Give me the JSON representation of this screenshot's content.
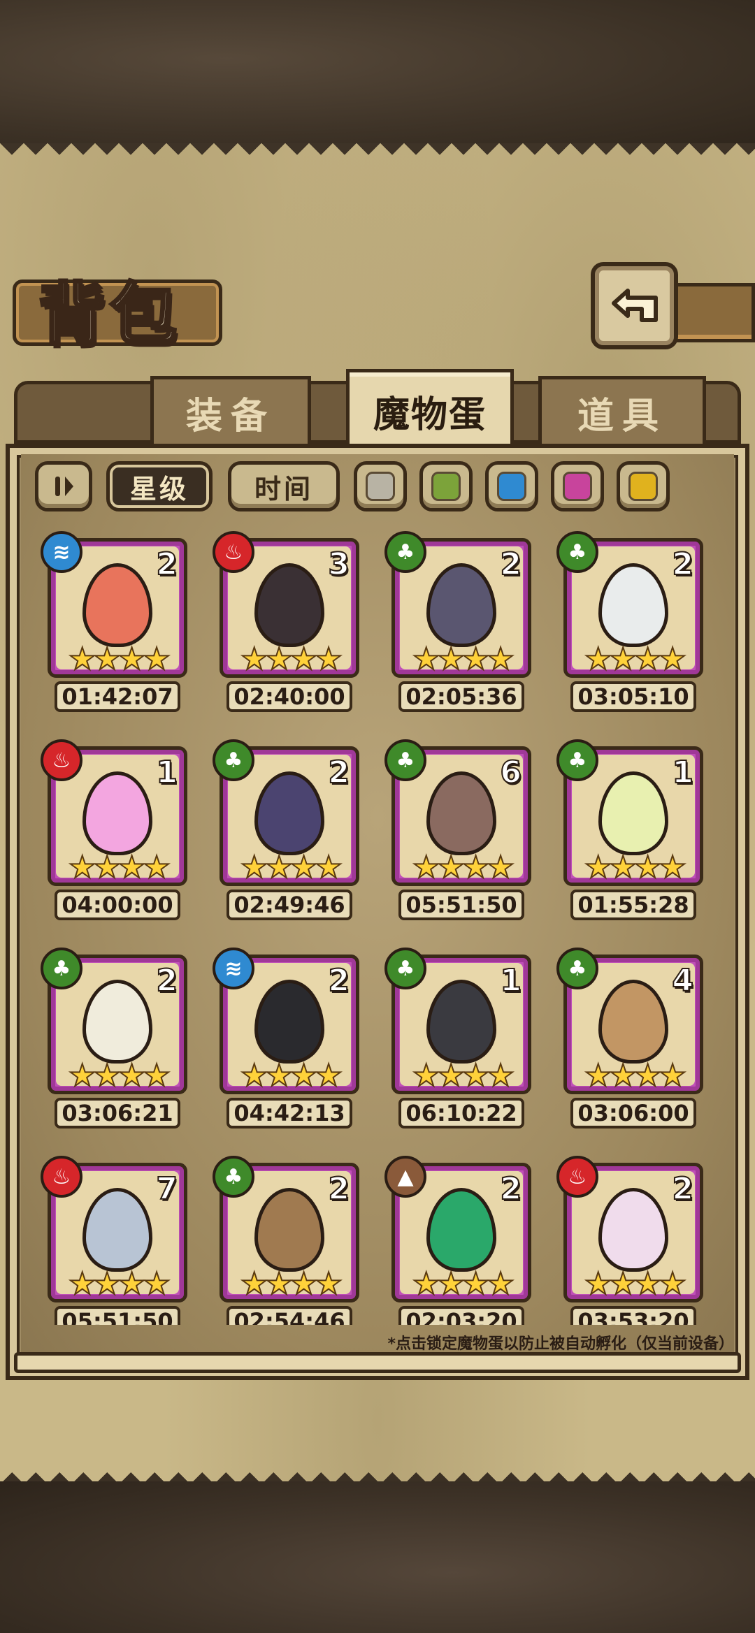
{
  "title": "背包",
  "tabs": [
    {
      "label": "装备",
      "active": false
    },
    {
      "label": "魔物蛋",
      "active": true
    },
    {
      "label": "道具",
      "active": false
    }
  ],
  "filters": {
    "sort_star": "星级",
    "sort_time": "时间",
    "colors": [
      "#b8b3a4",
      "#7ca33a",
      "#2f8ad1",
      "#c8449c",
      "#e0b21e"
    ]
  },
  "element_colors": {
    "water": "#2f8ad1",
    "fire": "#d6262a",
    "wood": "#3f8a2a",
    "earth": "#8a5a3a"
  },
  "eggs": [
    {
      "element": "water",
      "count": "2",
      "stars": "★★★★",
      "timer": "01:42:07",
      "color": "#e8745c"
    },
    {
      "element": "fire",
      "count": "3",
      "stars": "★★★★",
      "timer": "02:40:00",
      "color": "#3a3034"
    },
    {
      "element": "wood",
      "count": "2",
      "stars": "★★★★",
      "timer": "02:05:36",
      "color": "#5a5670"
    },
    {
      "element": "wood",
      "count": "2",
      "stars": "★★★★",
      "timer": "03:05:10",
      "color": "#e9ecec"
    },
    {
      "element": "fire",
      "count": "1",
      "stars": "★★★★",
      "timer": "04:00:00",
      "color": "#f3a6e0"
    },
    {
      "element": "wood",
      "count": "2",
      "stars": "★★★★",
      "timer": "02:49:46",
      "color": "#4b4470"
    },
    {
      "element": "wood",
      "count": "6",
      "stars": "★★★★",
      "timer": "05:51:50",
      "color": "#8a6a60"
    },
    {
      "element": "wood",
      "count": "1",
      "stars": "★★★★",
      "timer": "01:55:28",
      "color": "#e8f0b0"
    },
    {
      "element": "wood",
      "count": "2",
      "stars": "★★★★",
      "timer": "03:06:21",
      "color": "#f0ecdc"
    },
    {
      "element": "water",
      "count": "2",
      "stars": "★★★★",
      "timer": "04:42:13",
      "color": "#2a2a2e"
    },
    {
      "element": "wood",
      "count": "1",
      "stars": "★★★★",
      "timer": "06:10:22",
      "color": "#3a3a40"
    },
    {
      "element": "wood",
      "count": "4",
      "stars": "★★★★",
      "timer": "03:06:00",
      "color": "#c29664"
    },
    {
      "element": "fire",
      "count": "7",
      "stars": "★★★★",
      "timer": "05:51:50",
      "color": "#b8c4d4"
    },
    {
      "element": "wood",
      "count": "2",
      "stars": "★★★★",
      "timer": "02:54:46",
      "color": "#a07a50"
    },
    {
      "element": "earth",
      "count": "2",
      "stars": "★★★★",
      "timer": "02:03:20",
      "color": "#2aa86a"
    },
    {
      "element": "fire",
      "count": "2",
      "stars": "★★★★",
      "timer": "03:53:20",
      "color": "#f0dcec"
    }
  ],
  "note": "*点击锁定魔物蛋以防止被自动孵化（仅当前设备）"
}
